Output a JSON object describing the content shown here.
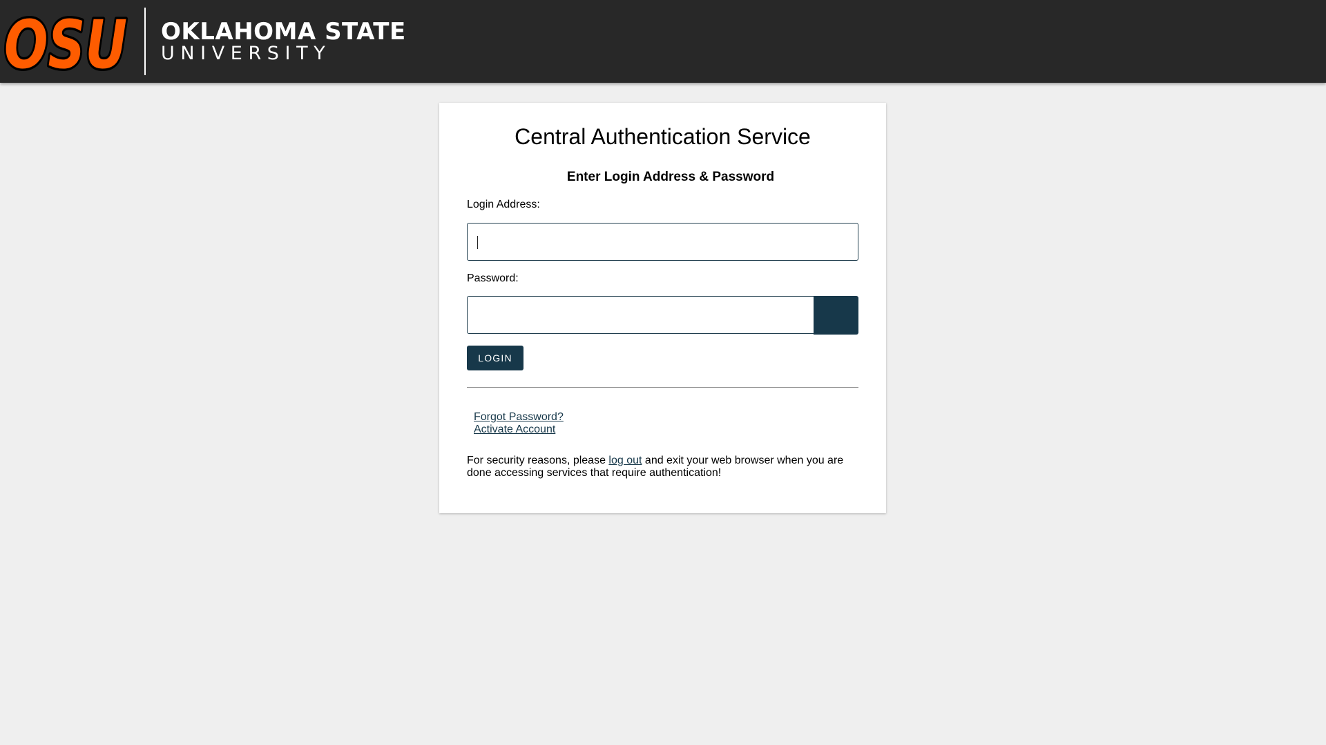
{
  "header": {
    "logo_mark_text": "OSU",
    "wordmark_line1": "OKLAHOMA STATE",
    "wordmark_line2": "UNIVERSITY",
    "colors": {
      "bar": "#282828",
      "brand_orange": "#fe5c00",
      "logo_outline": "#000000",
      "text": "#ffffff"
    }
  },
  "login_card": {
    "title": "Central Authentication Service",
    "subtitle": "Enter Login Address & Password",
    "login_address_label": "Login Address:",
    "login_address_value": "",
    "password_label": "Password:",
    "password_value": "",
    "login_button": "LOGIN",
    "forgot_password_link": "Forgot Password?",
    "activate_account_link": "Activate Account",
    "notice_before": "For security reasons, please ",
    "notice_link": "log out",
    "notice_after": " and exit your web browser when you are done accessing services that require authentication!",
    "colors": {
      "button_bg": "#17384a",
      "link": "#17384a",
      "page_bg": "#efefef",
      "card_bg": "#ffffff"
    }
  }
}
